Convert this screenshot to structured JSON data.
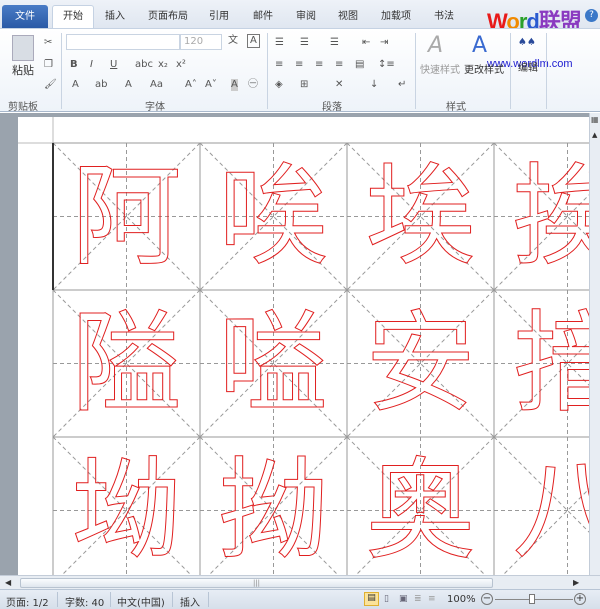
{
  "ribbon_tabs": {
    "file": "文件",
    "home": "开始",
    "insert": "插入",
    "layout": "页面布局",
    "references": "引用",
    "mailings": "邮件",
    "review": "审阅",
    "view": "视图",
    "addins": "加载项",
    "calligraphy": "书法"
  },
  "logo": {
    "word": "Word",
    "cn": "联盟",
    "url": "www.wordlm.com"
  },
  "clipboard": {
    "paste": "粘贴",
    "label": "剪贴板"
  },
  "font": {
    "name": "",
    "size": "120",
    "label": "字体"
  },
  "paragraph": {
    "label": "段落"
  },
  "styles": {
    "quick": "快速样式",
    "change": "更改样式",
    "label": "样式"
  },
  "editing": {
    "label": "编辑"
  },
  "grid_chars": [
    "阿",
    "唉",
    "埃",
    "挨",
    "隘",
    "嗌",
    "安",
    "揞",
    "坳",
    "拗",
    "奥",
    "八"
  ],
  "status": {
    "page": "页面: 1/2",
    "words": "字数: 40",
    "language": "中文(中国)",
    "mode": "插入",
    "zoom": "100%"
  },
  "colors": {
    "char_outline": "#e02020",
    "file_tab": "#2a5aa6"
  }
}
